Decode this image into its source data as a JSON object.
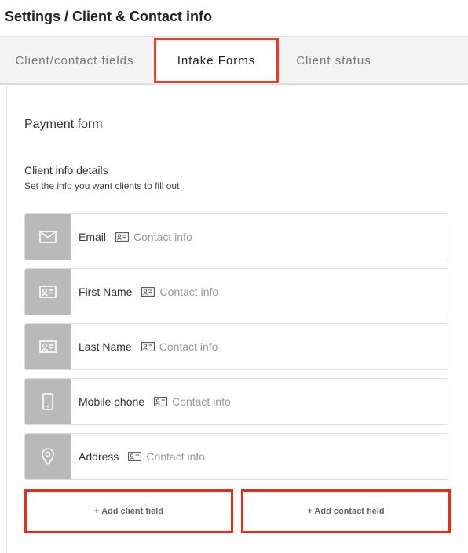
{
  "page": {
    "title": "Settings / Client & Contact info"
  },
  "tabs": [
    {
      "label": "Client/contact fields",
      "active": false
    },
    {
      "label": "Intake Forms",
      "active": true
    },
    {
      "label": "Client status",
      "active": false
    }
  ],
  "form": {
    "title": "Payment form",
    "section_title": "Client info details",
    "section_subtitle": "Set the info you want clients to fill out"
  },
  "fields": [
    {
      "label": "Email",
      "tag": "Contact info",
      "icon": "envelope-icon"
    },
    {
      "label": "First Name",
      "tag": "Contact info",
      "icon": "id-card-icon"
    },
    {
      "label": "Last Name",
      "tag": "Contact info",
      "icon": "id-card-icon"
    },
    {
      "label": "Mobile phone",
      "tag": "Contact info",
      "icon": "mobile-phone-icon"
    },
    {
      "label": "Address",
      "tag": "Contact info",
      "icon": "map-pin-icon"
    }
  ],
  "buttons": {
    "add_client_field": "+ Add client field",
    "add_contact_field": "+ Add contact field"
  },
  "colors": {
    "highlight": "#ef3a24",
    "icon_bg": "#b9b9b9",
    "tab_bar": "#f3f3f3"
  }
}
